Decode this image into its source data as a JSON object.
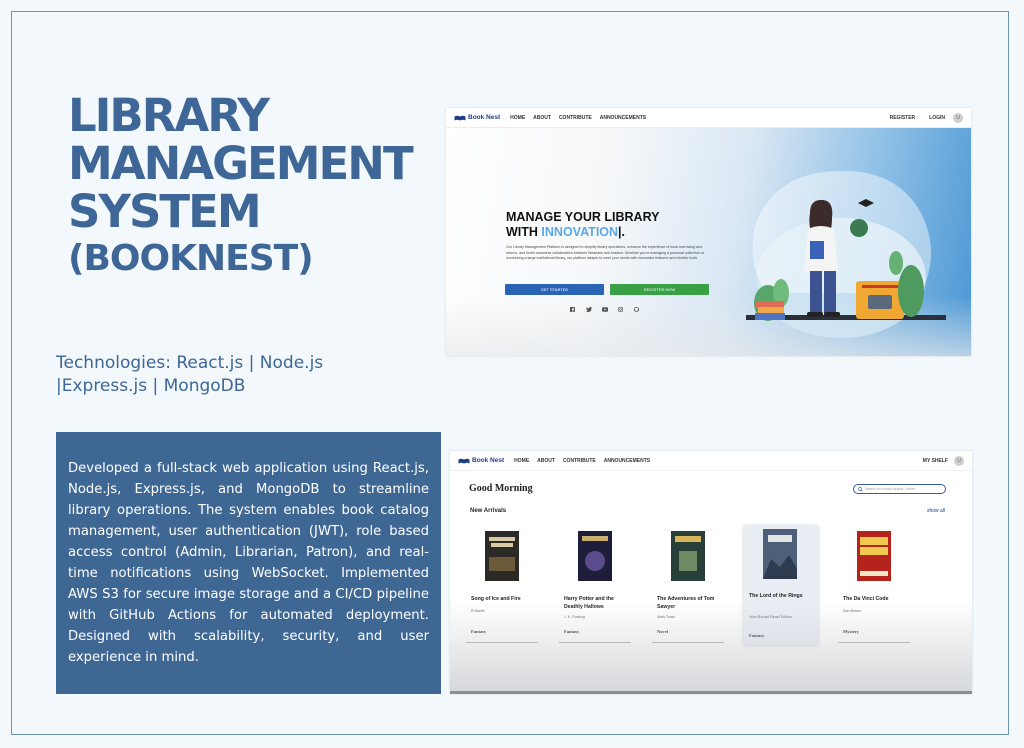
{
  "title": {
    "line1": "LIBRARY",
    "line2": "MANAGEMENT",
    "line3": "SYSTEM",
    "line4": "(BOOKNEST)"
  },
  "technologies": "Technologies: React.js | Node.js |Express.js | MongoDB",
  "description": "Developed a full-stack web application using React.js, Node.js, Express.js, and MongoDB to streamline library operations. The system enables book catalog management, user authentication (JWT), role based access control (Admin, Librarian, Patron), and real-time notifications using WebSocket. Implemented AWS S3 for secure image storage and a CI/CD pipeline with GitHub Actions for automated deployment. Designed with scalability, security, and user experience in mind.",
  "screenshot1": {
    "brand": "Book Nest",
    "nav": [
      "HOME",
      "ABOUT",
      "CONTRIBUTE",
      "ANNOUNCEMENTS"
    ],
    "register": "REGISTER",
    "login": "LOGIN",
    "avatar": "U",
    "hero_line1": "MANAGE YOUR LIBRARY",
    "hero_line2_prefix": "WITH ",
    "hero_accent": "INNOVATION",
    "hero_suffix": "|.",
    "hero_paragraph": "Our Library Management Platform is designed to simplify library operations, enhance the experience of book borrowing and returns, and foster seamless collaboration between librarians and readers. Whether you're managing a personal collection or overseeing a large institutional library, our platform adapts to meet your needs with innovative features and intuitive tools.",
    "get_started": "GET STARTED",
    "register_now": "REGISTER NOW",
    "socials": [
      "facebook-icon",
      "twitter-icon",
      "youtube-icon",
      "instagram-icon",
      "github-icon"
    ]
  },
  "screenshot2": {
    "brand": "Book Nest",
    "nav": [
      "HOME",
      "ABOUT",
      "CONTRIBUTE",
      "ANNOUNCEMENTS"
    ],
    "my_shelf": "MY SHELF",
    "avatar": "U",
    "greeting": "Good Morning",
    "search_placeholder": "Search for books, Author, Genre",
    "section": "New Arrivals",
    "show_all": "show all",
    "books": [
      {
        "title": "Song of Ice and Fire",
        "author": "R.Martin",
        "genre": "Fantasy",
        "cover_color": "#2b2a26"
      },
      {
        "title": "Harry Potter and the Deathly Hallows",
        "author": "J. K. Rowling",
        "genre": "Fantasy",
        "cover_color": "#1e1d3a"
      },
      {
        "title": "The Adventures of Tom Sawyer",
        "author": "Mark Twain",
        "genre": "Novel",
        "cover_color": "#264039"
      },
      {
        "title": "The Lord of the Rings",
        "author": "John Ronald Reuel Tolkien",
        "genre": "Fantasy",
        "cover_color": "#4d5f79"
      },
      {
        "title": "The Da Vinci Code",
        "author": "Dan Brown",
        "genre": "Mystery",
        "cover_color": "#b4241d"
      }
    ]
  }
}
